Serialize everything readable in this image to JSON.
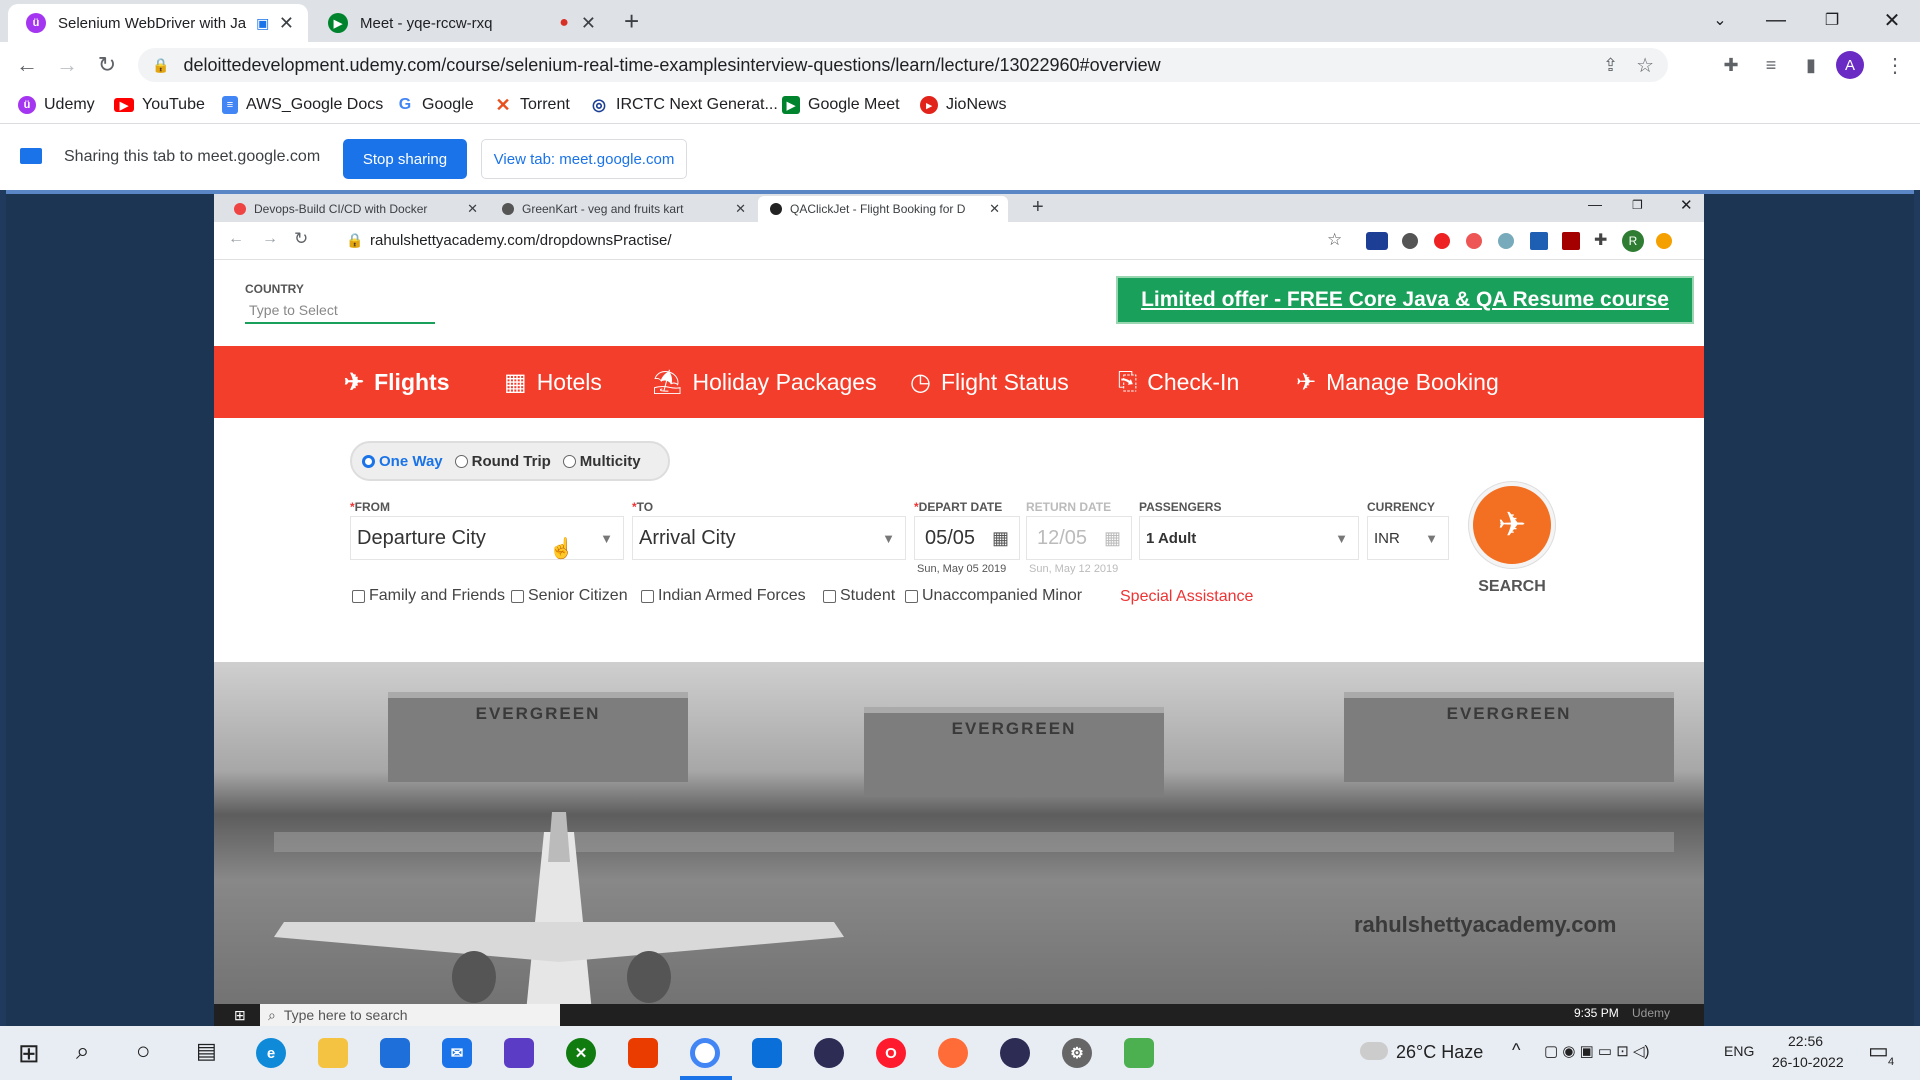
{
  "browser": {
    "tabs": [
      {
        "title": "Selenium WebDriver with Ja",
        "active": true
      },
      {
        "title": "Meet - yqe-rccw-rxq",
        "active": false
      }
    ],
    "url": "deloittedevelopment.udemy.com/course/selenium-real-time-examplesinterview-questions/learn/lecture/13022960#overview",
    "profile_initial": "A",
    "bookmarks": [
      "Udemy",
      "YouTube",
      "AWS_Google Docs",
      "Google",
      "Torrent",
      "IRCTC Next Generat...",
      "Google Meet",
      "JioNews"
    ]
  },
  "share": {
    "text": "Sharing this tab to meet.google.com",
    "stop_label": "Stop sharing",
    "view_label": "View tab: meet.google.com"
  },
  "inner": {
    "tabs": [
      {
        "title": "Devops-Build CI/CD with Docker"
      },
      {
        "title": "GreenKart - veg and fruits kart"
      },
      {
        "title": "QAClickJet - Flight Booking for D"
      }
    ],
    "url": "rahulshettyacademy.com/dropdownsPractise/",
    "profile_initial": "R",
    "country": {
      "label": "COUNTRY",
      "placeholder": "Type to Select"
    },
    "offer": "Limited offer - FREE Core Java & QA Resume course",
    "nav": [
      "Flights",
      "Hotels",
      "Holiday Packages",
      "Flight Status",
      "Check-In",
      "Manage Booking"
    ],
    "trip": [
      "One Way",
      "Round Trip",
      "Multicity"
    ],
    "from": {
      "label": "FROM",
      "value": "Departure City"
    },
    "to": {
      "label": "TO",
      "value": "Arrival City"
    },
    "depart": {
      "label": "DEPART DATE",
      "value": "05/05",
      "sub": "Sun, May 05 2019"
    },
    "return": {
      "label": "RETURN DATE",
      "value": "12/05",
      "sub": "Sun, May 12 2019"
    },
    "passengers": {
      "label": "PASSENGERS",
      "value": "1 Adult"
    },
    "currency": {
      "label": "CURRENCY",
      "value": "INR"
    },
    "search": "SEARCH",
    "checks": [
      "Family and Friends",
      "Senior Citizen",
      "Indian Armed Forces",
      "Student",
      "Unaccompanied Minor"
    ],
    "special": "Special Assistance",
    "hangar_text": "EVERGREEN",
    "watermark": "rahulshettyacademy.com",
    "taskbar_search": "Type here to search",
    "taskbar_time": "9:35 PM",
    "taskbar_app": "Udemy"
  },
  "taskbar": {
    "weather": "26°C Haze",
    "lang": "ENG",
    "time": "22:56",
    "date": "26-10-2022",
    "notif": "4"
  }
}
